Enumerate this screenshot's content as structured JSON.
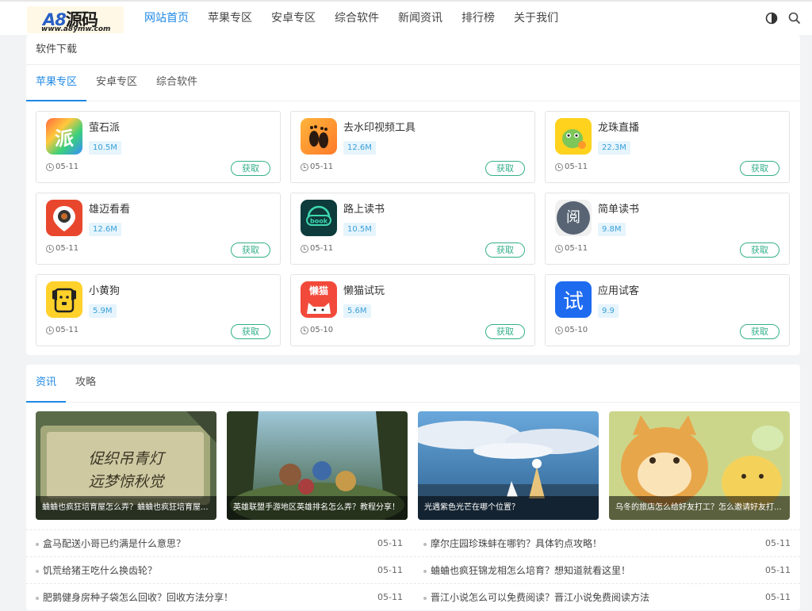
{
  "header": {
    "logo_main": "A8",
    "logo_cn": "源码",
    "logo_sub": "www.a8ymw.com",
    "nav": [
      "网站首页",
      "苹果专区",
      "安卓专区",
      "综合软件",
      "新闻资讯",
      "排行榜",
      "关于我们"
    ],
    "active_nav": 0,
    "theme_icon": "contrast-icon",
    "search_icon": "search-icon"
  },
  "software": {
    "title": "软件下载",
    "tabs": [
      "苹果专区",
      "安卓专区",
      "综合软件"
    ],
    "active_tab": 0,
    "apps": [
      {
        "name": "萤石派",
        "size": "10.5M",
        "date": "05-11",
        "button": "获取",
        "icon": "萤石派-icon",
        "glyph": "派"
      },
      {
        "name": "去水印视频工具",
        "size": "12.6M",
        "date": "05-11",
        "button": "获取",
        "icon": "footprint-icon",
        "glyph": ""
      },
      {
        "name": "龙珠直播",
        "size": "22.3M",
        "date": "05-11",
        "button": "获取",
        "icon": "dragon-icon",
        "glyph": ""
      },
      {
        "name": "雄迈看看",
        "size": "12.6M",
        "date": "05-11",
        "button": "获取",
        "icon": "camera-icon",
        "glyph": ""
      },
      {
        "name": "路上读书",
        "size": "10.5M",
        "date": "05-11",
        "button": "获取",
        "icon": "book-icon",
        "glyph": "book"
      },
      {
        "name": "简单读书",
        "size": "9.8M",
        "date": "05-11",
        "button": "获取",
        "icon": "read-icon",
        "glyph": "阅"
      },
      {
        "name": "小黄狗",
        "size": "5.9M",
        "date": "05-11",
        "button": "获取",
        "icon": "dog-icon",
        "glyph": ""
      },
      {
        "name": "懒猫试玩",
        "size": "5.6M",
        "date": "05-10",
        "button": "获取",
        "icon": "cat-icon",
        "glyph": "懒猫"
      },
      {
        "name": "应用试客",
        "size": "9.9",
        "date": "05-10",
        "button": "获取",
        "icon": "try-icon",
        "glyph": "试"
      }
    ]
  },
  "news": {
    "tabs": [
      "资讯",
      "攻略"
    ],
    "active_tab": 0,
    "featured": [
      {
        "caption": "蛐蛐也疯狂培育屋怎么弄？蛐蛐也疯狂培育屋...",
        "image": "game-sign-image",
        "sign_text_1": "促织吊青灯",
        "sign_text_2": "远梦惊秋觉"
      },
      {
        "caption": "英雄联盟手游地区英雄排名怎么弄？教程分享！",
        "image": "battle-scene-image"
      },
      {
        "caption": "光遇紫色光芒在哪个位置？",
        "image": "sky-scene-image"
      },
      {
        "caption": "乌冬的旅店怎么给好友打工？怎么邀请好友打...",
        "image": "cat-inn-image"
      }
    ],
    "left_list": [
      {
        "title": "盒马配送小哥已约满是什么意思？",
        "date": "05-11"
      },
      {
        "title": "饥荒给猪王吃什么换齿轮？",
        "date": "05-11"
      },
      {
        "title": "肥鹅健身房种子袋怎么回收？回收方法分享！",
        "date": "05-11"
      }
    ],
    "right_list": [
      {
        "title": "摩尔庄园珍珠蚌在哪钓？具体钓点攻略！",
        "date": "05-11"
      },
      {
        "title": "蛐蛐也疯狂锦龙相怎么培育？想知道就看这里！",
        "date": "05-11"
      },
      {
        "title": "晋江小说怎么可以免费阅读？晋江小说免费阅读方法",
        "date": "05-11"
      }
    ]
  },
  "colors": {
    "accent": "#1e88e5",
    "get_button": "#34b08a",
    "size_badge_bg": "#e6f4fc"
  }
}
